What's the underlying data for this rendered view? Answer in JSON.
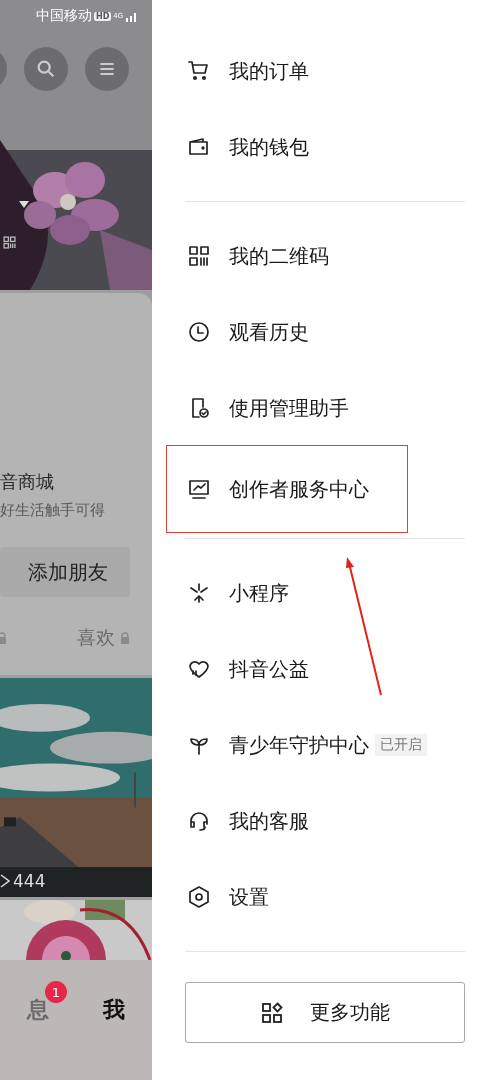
{
  "status_bar": {
    "carrier": "中国移动",
    "badge": "HD",
    "network": "4G"
  },
  "profile": {
    "shop_title": "音商城",
    "shop_subtitle": "好生活触手可得",
    "add_friend_button": "添加朋友",
    "tab": {
      "label": "喜欢",
      "locked": true
    }
  },
  "video_views": "444",
  "bottom_nav": [
    {
      "label": "息",
      "badge": "1",
      "selected": false
    },
    {
      "label": "我",
      "selected": true
    }
  ],
  "menu": {
    "groups": [
      [
        {
          "label": "我的订单",
          "highlighted": false
        },
        {
          "label": "我的钱包",
          "highlighted": false
        }
      ],
      [
        {
          "label": "我的二维码",
          "highlighted": false
        },
        {
          "label": "观看历史",
          "highlighted": false
        },
        {
          "label": "使用管理助手",
          "highlighted": false
        },
        {
          "label": "创作者服务中心",
          "highlighted": true
        }
      ],
      [
        {
          "label": "小程序",
          "highlighted": false
        },
        {
          "label": "抖音公益",
          "highlighted": false
        },
        {
          "label": "青少年守护中心",
          "tag": "已开启",
          "highlighted": false
        },
        {
          "label": "我的客服",
          "highlighted": false
        },
        {
          "label": "设置",
          "highlighted": false
        }
      ]
    ],
    "more_button": "更多功能"
  }
}
